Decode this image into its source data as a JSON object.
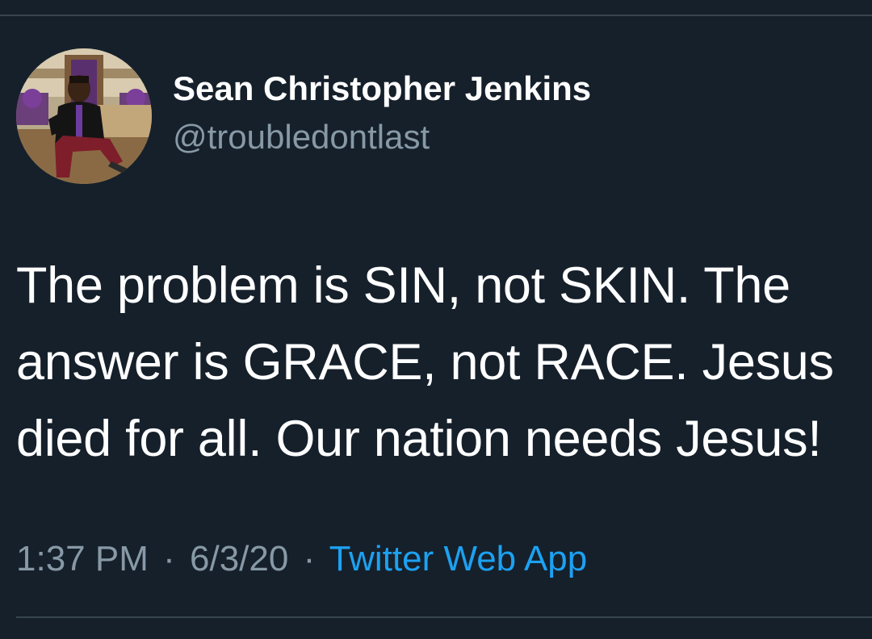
{
  "tweet": {
    "author": {
      "display_name": "Sean Christopher Jenkins",
      "handle": "@troubledontlast"
    },
    "text": "The problem is SIN, not SKIN. The answer is GRACE, not RACE. Jesus died for all. Our nation needs Jesus!",
    "time": "1:37 PM",
    "separator": "·",
    "date": "6/3/20",
    "source": "Twitter Web App"
  },
  "colors": {
    "background": "#15202b",
    "text_primary": "#ffffff",
    "text_secondary": "#8899a6",
    "link": "#1da1f2",
    "divider": "#38444d"
  },
  "icons": {
    "avatar": "profile-photo"
  }
}
